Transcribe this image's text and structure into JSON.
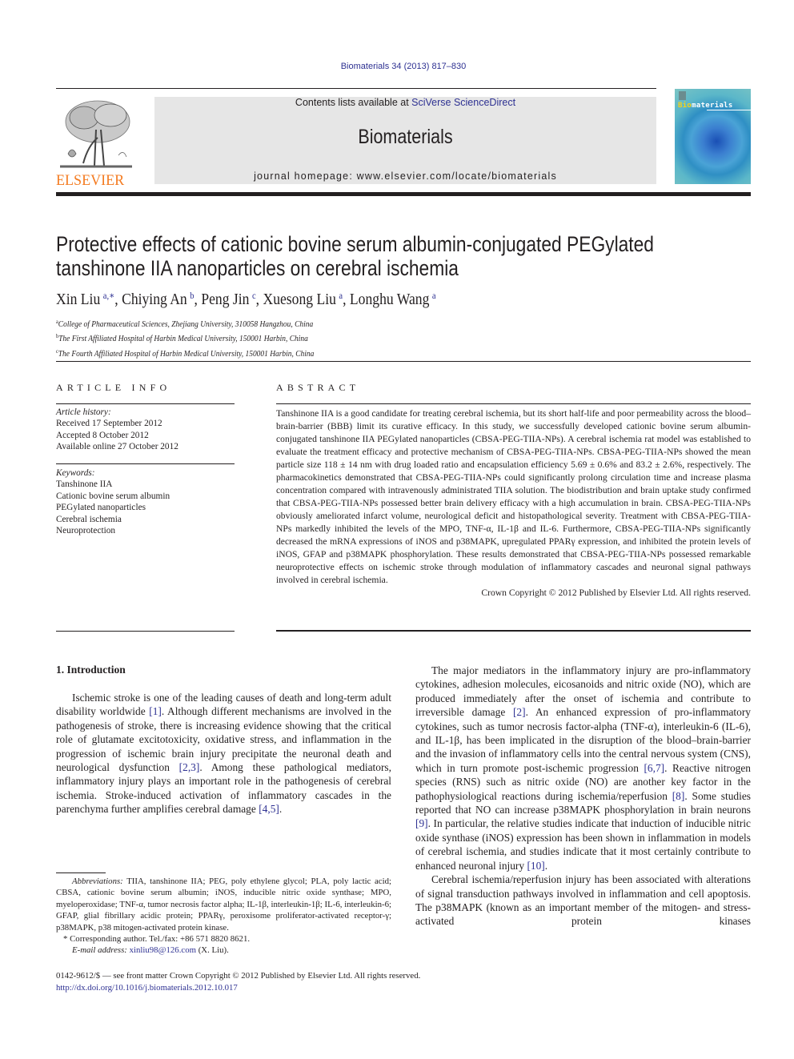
{
  "header": {
    "journal_ref": "Biomaterials 34 (2013) 817–830",
    "contents_prefix": "Contents lists available at ",
    "contents_link": "SciVerse ScienceDirect",
    "journal_name": "Biomaterials",
    "homepage": "journal homepage: www.elsevier.com/locate/biomaterials",
    "publisher_logo_text": "ELSEVIER",
    "cover_title_accent": "Bio",
    "cover_title_rest": "materials",
    "colors": {
      "link": "#2e3192",
      "elsevier_orange": "#f47b20",
      "banner_gray": "#e6e6e6"
    }
  },
  "article": {
    "title_line1": "Protective effects of cationic bovine serum albumin-conjugated PEGylated",
    "title_line2": "tanshinone IIA nanoparticles on cerebral ischemia",
    "authors": [
      {
        "name": "Xin Liu",
        "sup": "a,∗",
        "sep": ", "
      },
      {
        "name": "Chiying An",
        "sup": "b",
        "sep": ", "
      },
      {
        "name": "Peng Jin",
        "sup": "c",
        "sep": ", "
      },
      {
        "name": "Xuesong Liu",
        "sup": "a",
        "sep": ", "
      },
      {
        "name": "Longhu Wang",
        "sup": "a",
        "sep": ""
      }
    ],
    "affiliations": [
      {
        "sup": "a",
        "text": "College of Pharmaceutical Sciences, Zhejiang University, 310058 Hangzhou, China"
      },
      {
        "sup": "b",
        "text": "The First Affiliated Hospital of Harbin Medical University, 150001 Harbin, China"
      },
      {
        "sup": "c",
        "text": "The Fourth Affiliated Hospital of Harbin Medical University, 150001 Harbin, China"
      }
    ]
  },
  "article_info": {
    "heading": "ARTICLE INFO",
    "history_label": "Article history:",
    "history": [
      "Received 17 September 2012",
      "Accepted 8 October 2012",
      "Available online 27 October 2012"
    ],
    "keywords_label": "Keywords:",
    "keywords": [
      "Tanshinone IIA",
      "Cationic bovine serum albumin",
      "PEGylated nanoparticles",
      "Cerebral ischemia",
      "Neuroprotection"
    ]
  },
  "abstract": {
    "heading": "ABSTRACT",
    "text": "Tanshinone IIA is a good candidate for treating cerebral ischemia, but its short half-life and poor permeability across the blood–brain-barrier (BBB) limit its curative efficacy. In this study, we successfully developed cationic bovine serum albumin-conjugated tanshinone IIA PEGylated nanoparticles (CBSA-PEG-TIIA-NPs). A cerebral ischemia rat model was established to evaluate the treatment efficacy and protective mechanism of CBSA-PEG-TIIA-NPs. CBSA-PEG-TIIA-NPs showed the mean particle size 118 ± 14 nm with drug loaded ratio and encapsulation efficiency 5.69 ± 0.6% and 83.2 ± 2.6%, respectively. The pharmacokinetics demonstrated that CBSA-PEG-TIIA-NPs could significantly prolong circulation time and increase plasma concentration compared with intravenously administrated TIIA solution. The biodistribution and brain uptake study confirmed that CBSA-PEG-TIIA-NPs possessed better brain delivery efficacy with a high accumulation in brain. CBSA-PEG-TIIA-NPs obviously ameliorated infarct volume, neurological deficit and histopathological severity. Treatment with CBSA-PEG-TIIA-NPs markedly inhibited the levels of the MPO, TNF-α, IL-1β and IL-6. Furthermore, CBSA-PEG-TIIA-NPs significantly decreased the mRNA expressions of iNOS and p38MAPK, upregulated PPARγ expression, and inhibited the protein levels of iNOS, GFAP and p38MAPK phosphorylation. These results demonstrated that CBSA-PEG-TIIA-NPs possessed remarkable neuroprotective effects on ischemic stroke through modulation of inflammatory cascades and neuronal signal pathways involved in cerebral ischemia.",
    "copyright": "Crown Copyright © 2012 Published by Elsevier Ltd. All rights reserved."
  },
  "intro": {
    "heading": "1.  Introduction",
    "p1": [
      {
        "t": "Ischemic stroke is one of the leading causes of death and long-term adult disability worldwide "
      },
      {
        "ref": "[1]"
      },
      {
        "t": ". Although different mechanisms are involved in the pathogenesis of stroke, there is increasing evidence showing that the critical role of glutamate excitotoxicity, oxidative stress, and inflammation in the progression of ischemic brain injury precipitate the neuronal death and neurological dysfunction "
      },
      {
        "ref": "[2,3]"
      },
      {
        "t": ". Among these pathological mediators, inflammatory injury plays an important role in the pathogenesis of cerebral ischemia. Stroke-induced activation of inflammatory cascades in the parenchyma further amplifies cerebral damage "
      },
      {
        "ref": "[4,5]"
      },
      {
        "t": "."
      }
    ],
    "p2": [
      {
        "t": "The major mediators in the inflammatory injury are pro-inflammatory cytokines, adhesion molecules, eicosanoids and nitric oxide (NO), which are produced immediately after the onset of ischemia and contribute to irreversible damage "
      },
      {
        "ref": "[2]"
      },
      {
        "t": ". An enhanced expression of pro-inflammatory cytokines, such as tumor necrosis factor-alpha (TNF-α), interleukin-6 (IL-6), and IL-1β, has been implicated in the disruption of the blood–brain-barrier and the invasion of inflammatory cells into the central nervous system (CNS), which in turn promote post-ischemic progression "
      },
      {
        "ref": "[6,7]"
      },
      {
        "t": ". Reactive nitrogen species (RNS) such as nitric oxide (NO) are another key factor in the pathophysiological reactions during ischemia/reperfusion "
      },
      {
        "ref": "[8]"
      },
      {
        "t": ". Some studies reported that NO can increase p38MAPK phosphorylation in brain neurons "
      },
      {
        "ref": "[9]"
      },
      {
        "t": ". In particular, the relative studies indicate that induction of inducible nitric oxide synthase (iNOS) expression has been shown in inflammation in models of cerebral ischemia, and studies indicate that it most certainly contribute to enhanced neuronal injury "
      },
      {
        "ref": "[10]"
      },
      {
        "t": "."
      }
    ],
    "p3": "Cerebral ischemia/reperfusion injury has been associated with alterations of signal transduction pathways involved in inflammation and cell apoptosis. The p38MAPK (known as an important member of the mitogen- and stress-activated protein kinases"
  },
  "footnotes": {
    "abbrev_label": "Abbreviations:",
    "abbrev_text": " TIIA, tanshinone IIA; PEG, poly ethylene glycol; PLA, poly lactic acid; CBSA, cationic bovine serum albumin; iNOS, inducible nitric oxide synthase; MPO, myeloperoxidase; TNF-α, tumor necrosis factor alpha; IL-1β, interleukin-1β; IL-6, interleukin-6; GFAP, glial fibrillary acidic protein; PPARγ, peroxisome proliferator-activated receptor-γ; p38MAPK, p38 mitogen-activated protein kinase.",
    "corresponding": "* Corresponding author. Tel./fax: +86 571 8820 8621.",
    "email_label": "E-mail address:",
    "email": "xinliu98@126.com",
    "email_suffix": " (X. Liu)."
  },
  "bottom": {
    "issn_line": "0142-9612/$ — see front matter Crown Copyright © 2012 Published by Elsevier Ltd. All rights reserved.",
    "doi": "http://dx.doi.org/10.1016/j.biomaterials.2012.10.017"
  }
}
